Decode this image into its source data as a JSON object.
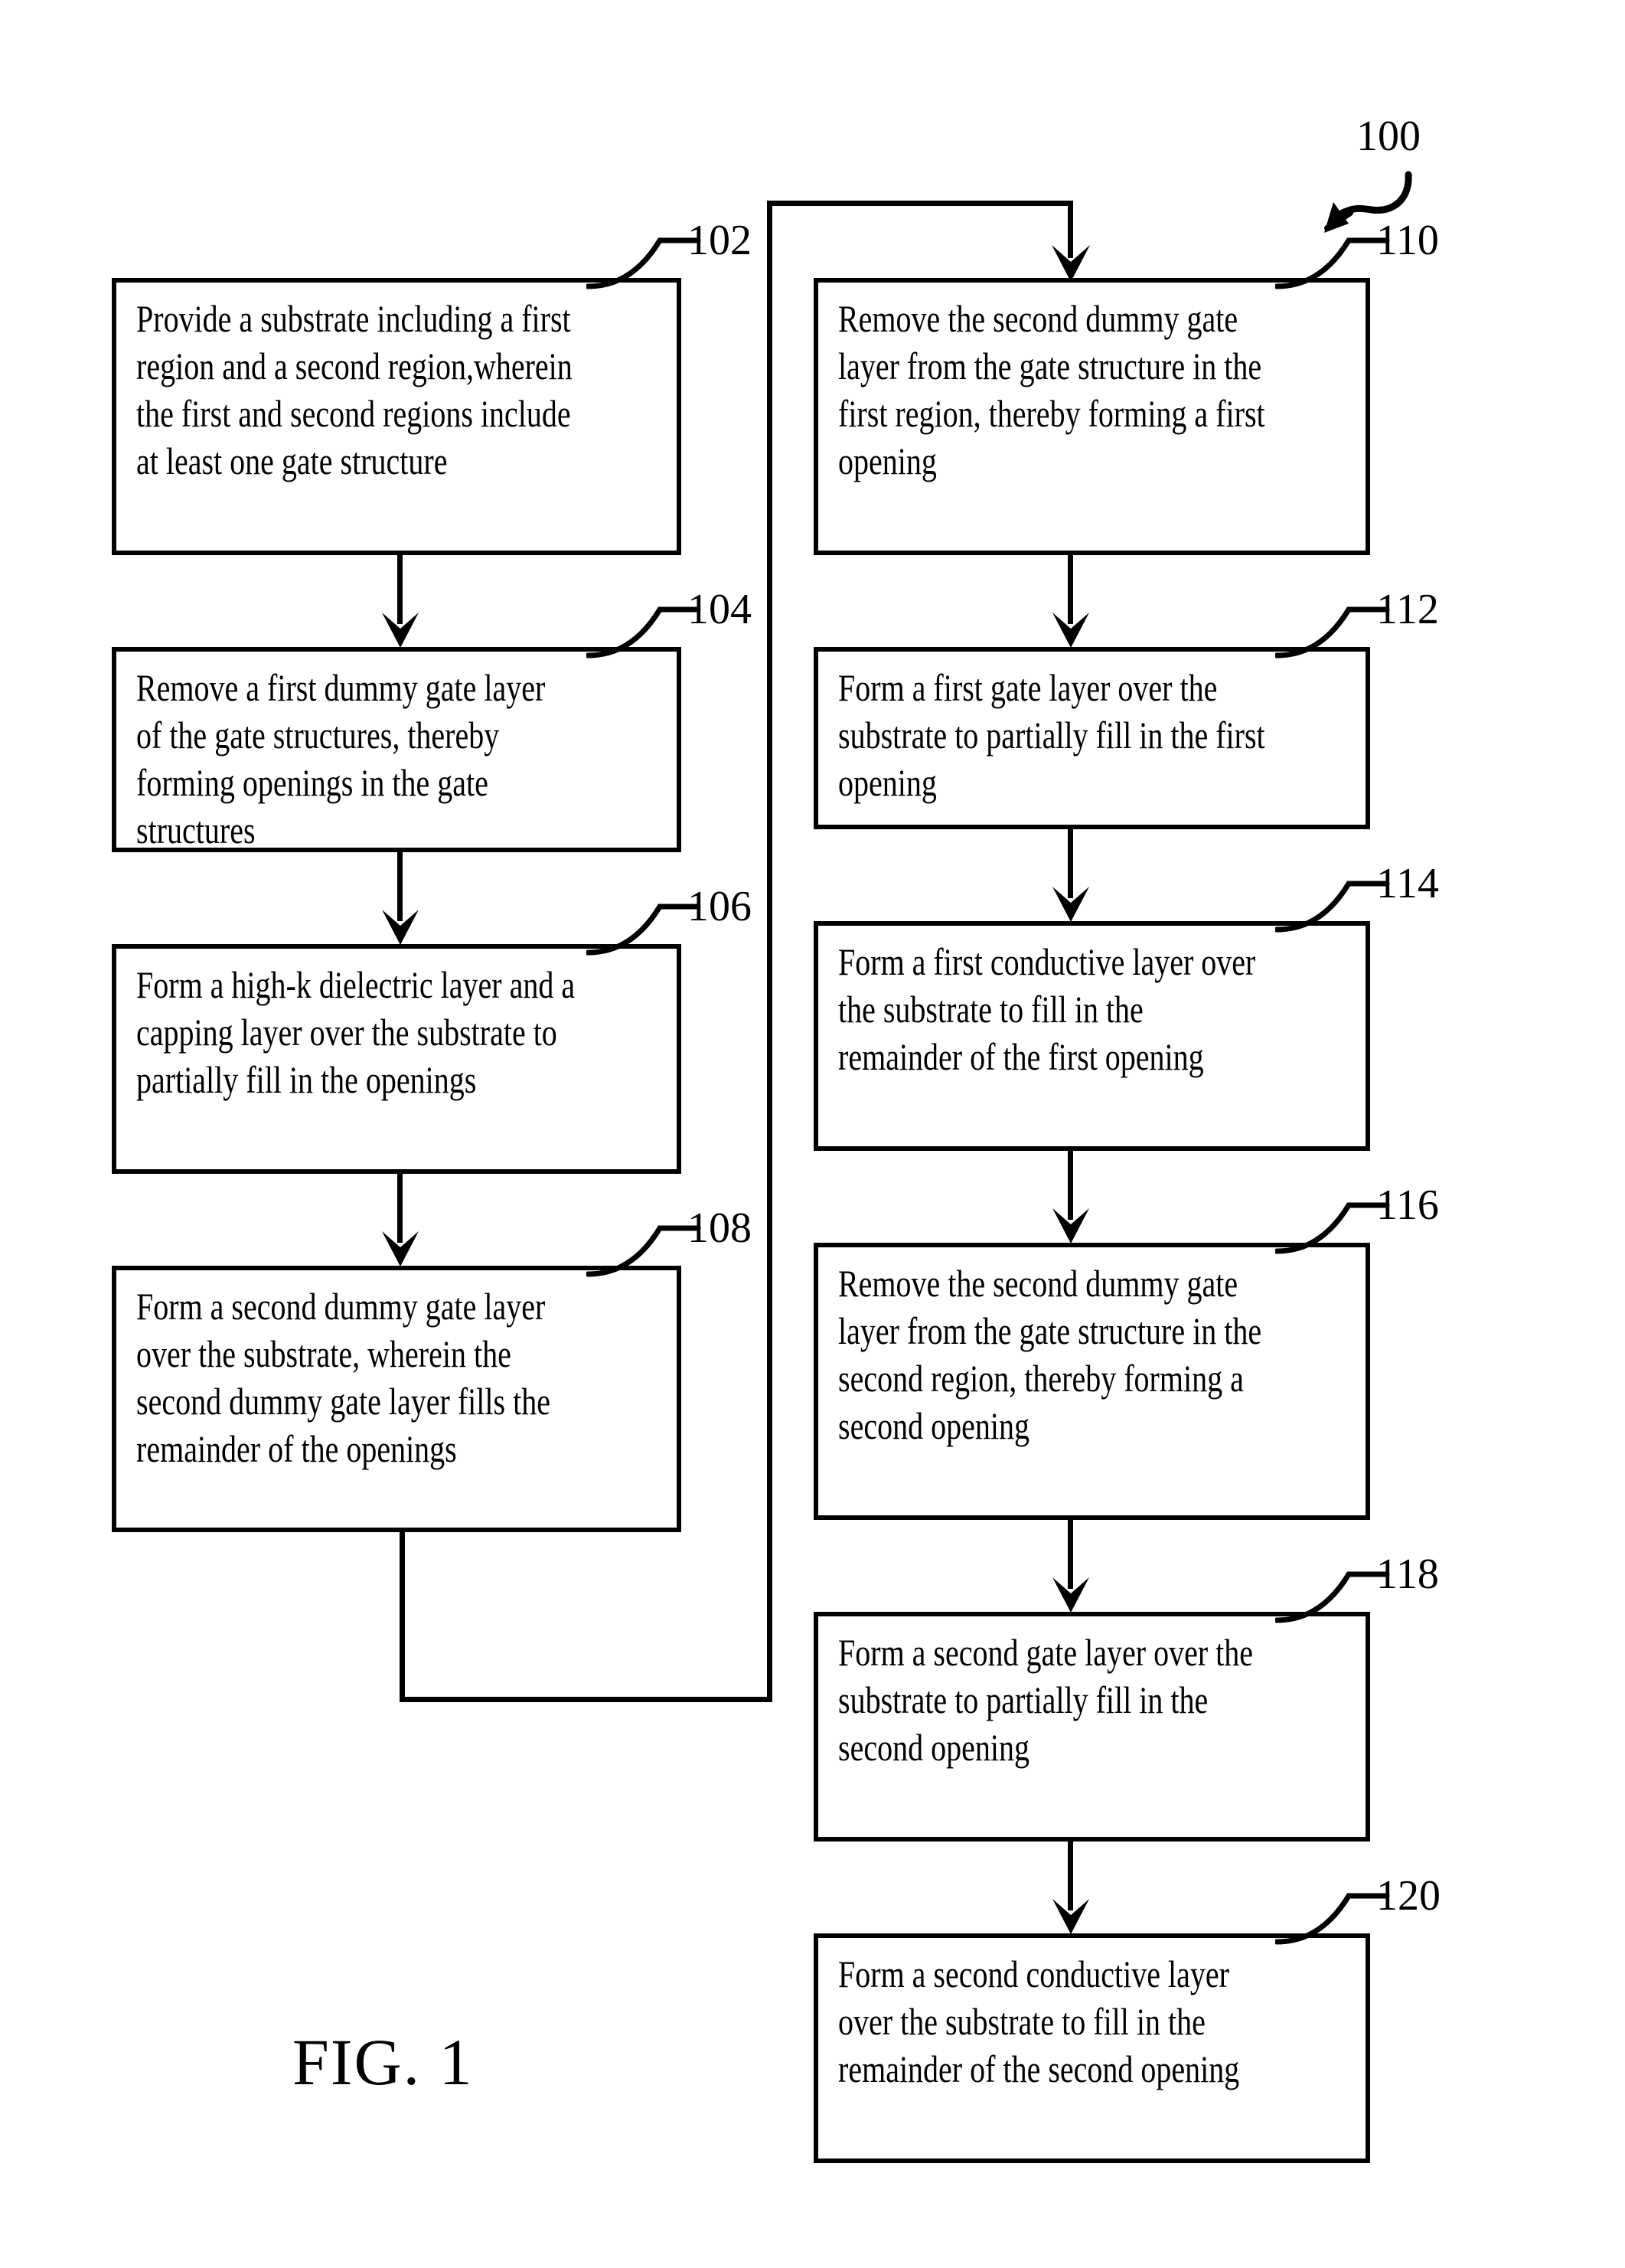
{
  "figure": {
    "caption": "FIG. 1",
    "flow_label": "100"
  },
  "flowchart": {
    "type": "process-flowchart",
    "left_column": [
      {
        "ref": "102",
        "text": "Provide a substrate including a first region and a second region,wherein the first and second regions include at least one gate structure"
      },
      {
        "ref": "104",
        "text": "Remove a first dummy gate layer of the gate structures, thereby forming openings in the gate structures"
      },
      {
        "ref": "106",
        "text": "Form a high-k dielectric layer and a capping layer over the substrate to partially fill in the openings"
      },
      {
        "ref": "108",
        "text": "Form a second dummy gate layer over the substrate, wherein the second dummy gate layer fills the remainder of the openings"
      }
    ],
    "right_column": [
      {
        "ref": "110",
        "text": "Remove the second dummy gate layer from the gate structure in the first region, thereby forming a first opening"
      },
      {
        "ref": "112",
        "text": "Form a first gate layer over the substrate to partially fill in the first opening"
      },
      {
        "ref": "114",
        "text": "Form a first conductive layer over the substrate to fill in the remainder of the first opening"
      },
      {
        "ref": "116",
        "text": "Remove the second dummy gate layer from the gate structure in the second region, thereby forming a second opening"
      },
      {
        "ref": "118",
        "text": "Form a second gate layer over the substrate to partially fill in the second opening"
      },
      {
        "ref": "120",
        "text": "Form a second conductive layer over the substrate to fill in the remainder of the second opening"
      }
    ]
  },
  "colors": {
    "ink": "#000000",
    "paper": "#ffffff"
  }
}
